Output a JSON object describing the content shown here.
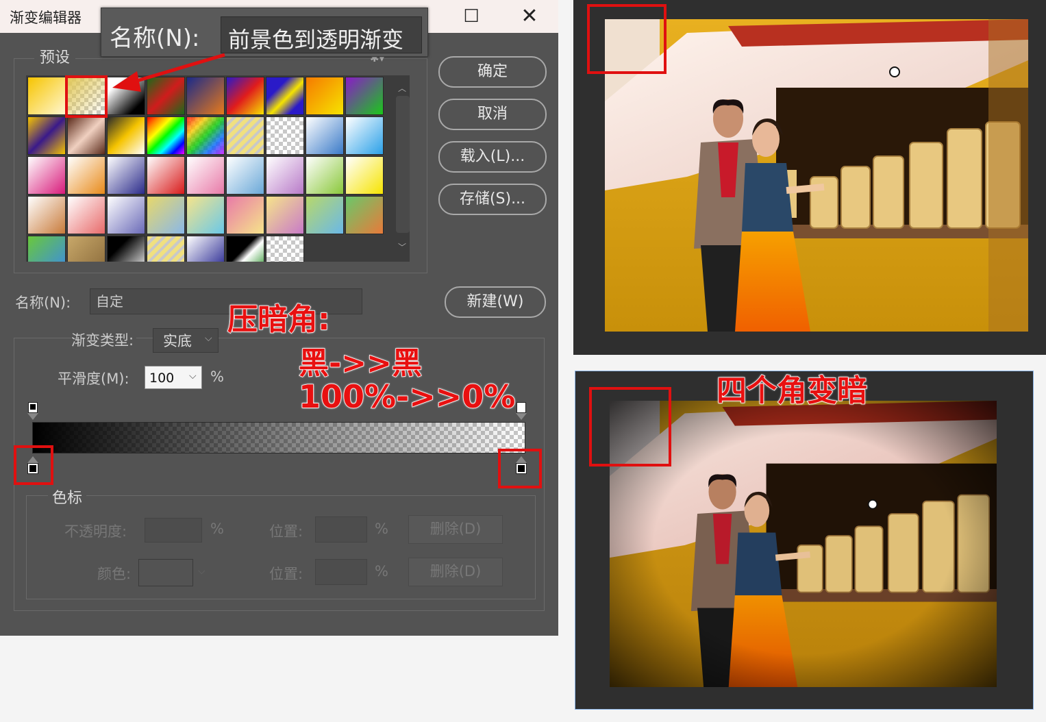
{
  "dialog": {
    "title": "渐变编辑器",
    "callout": {
      "label": "名称(N):",
      "value": "前景色到透明渐变"
    },
    "presets_label": "预设",
    "buttons": {
      "ok": "确定",
      "cancel": "取消",
      "load": "载入(L)...",
      "save": "存储(S)...",
      "new": "新建(W)"
    },
    "name_label": "名称(N):",
    "name_value": "自定",
    "gradient_type_label": "渐变类型:",
    "gradient_type_value": "实底",
    "smoothness_label": "平滑度(M):",
    "smoothness_value": "100",
    "percent": "%",
    "stops": {
      "legend": "色标",
      "opacity_label": "不透明度:",
      "location_label": "位置:",
      "delete_label": "删除(D)",
      "color_label": "颜色:"
    }
  },
  "annotations": {
    "vignette": "压暗角:",
    "black_to_black": "黑->>黑",
    "opacity_range": "100%->>0%",
    "four_corners": "四个角变暗"
  },
  "colors": {
    "annotation_red": "#e81010",
    "dialog_bg": "#535353",
    "panel_bg": "#2f2f2f"
  }
}
